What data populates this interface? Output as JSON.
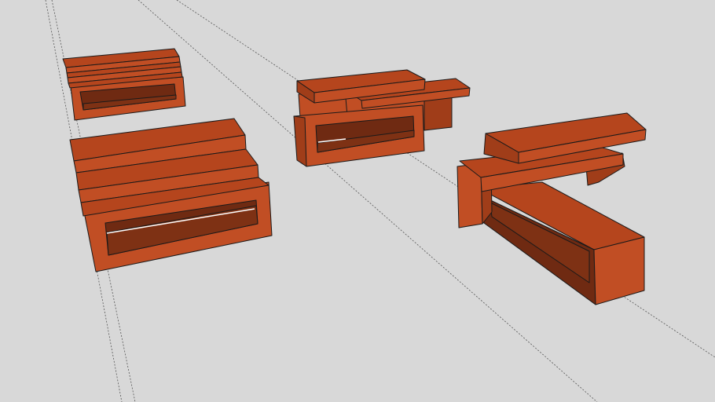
{
  "viewport": {
    "background_color": "#d8d8d8"
  },
  "colors": {
    "top_face": "#b5451d",
    "front_face": "#c14e24",
    "side_face": "#a03d19",
    "shadow_face": "#6f2a12",
    "inner_face": "#7e3114",
    "edge": "#1a1a1a",
    "guide_line": "#555555"
  },
  "objects": [
    {
      "name": "model-stacked-frames-small"
    },
    {
      "name": "model-stacked-frames-large"
    },
    {
      "name": "model-frame-with-shelves"
    },
    {
      "name": "model-l-shaped-frame-with-shelves"
    }
  ]
}
